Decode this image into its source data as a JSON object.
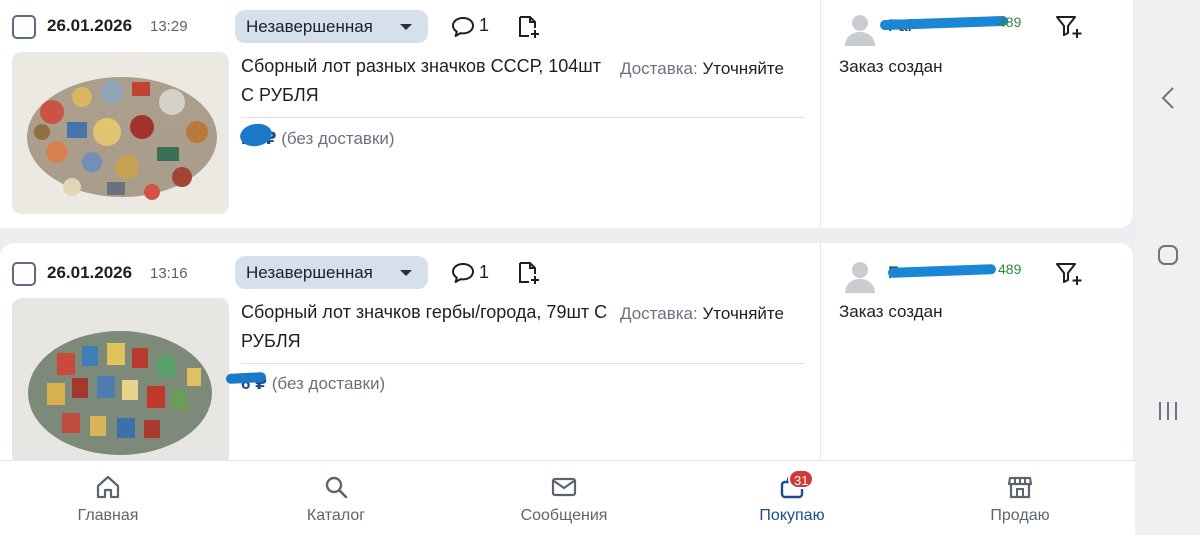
{
  "orders": [
    {
      "date": "26.01.2026",
      "time": "13:29",
      "status": "Незавершенная",
      "comments": "1",
      "title": "Сборный лот разных значков СССР, 104шт С РУБЛЯ",
      "delivery_label": "Доставка:",
      "delivery_value": "Уточняйте",
      "price": "10 ₽",
      "price_note": "(без доставки)",
      "seller_name": "Fal",
      "seller_rating": "489",
      "order_status": "Заказ создан"
    },
    {
      "date": "26.01.2026",
      "time": "13:16",
      "status": "Незавершенная",
      "comments": "1",
      "title": "Сборный лот значков гербы/города, 79шт С РУБЛЯ",
      "delivery_label": "Доставка:",
      "delivery_value": "Уточняйте",
      "price": "6 ₽",
      "price_note": "(без доставки)",
      "seller_name": "F",
      "seller_rating": "489",
      "order_status": "Заказ создан"
    }
  ],
  "bottom_nav": [
    {
      "label": "Главная",
      "icon": "home-icon"
    },
    {
      "label": "Каталог",
      "icon": "search-icon"
    },
    {
      "label": "Сообщения",
      "icon": "mail-icon"
    },
    {
      "label": "Покупаю",
      "icon": "bag-icon",
      "badge": "31",
      "active": true
    },
    {
      "label": "Продаю",
      "icon": "store-icon"
    }
  ],
  "colors": {
    "accent": "#1e4b8f",
    "status_chip": "#d6e0ec",
    "badge": "#d23a3a",
    "rating": "#2f8a3c",
    "redaction": "#1a86d6"
  }
}
